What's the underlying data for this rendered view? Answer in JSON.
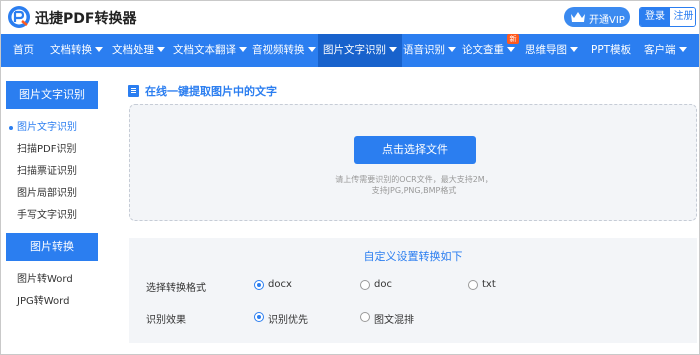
{
  "header": {
    "brand": "迅捷PDF转换器",
    "vip_label": "开通VIP",
    "login_label": "登录",
    "register_label": "注册"
  },
  "nav": {
    "items": [
      {
        "label": "首页"
      },
      {
        "label": "文档转换"
      },
      {
        "label": "文档处理"
      },
      {
        "label": "文档文本翻译"
      },
      {
        "label": "音视频转换"
      },
      {
        "label": "图片文字识别",
        "active": true
      },
      {
        "label": "语音识别"
      },
      {
        "label": "论文查重"
      },
      {
        "label": "思维导图"
      },
      {
        "label": "PPT模板"
      },
      {
        "label": "客户端"
      }
    ],
    "new_badge": "新"
  },
  "sidebar": {
    "section1_title": "图片文字识别",
    "section1_items": [
      "图片文字识别",
      "扫描PDF识别",
      "扫描票证识别",
      "图片局部识别",
      "手写文字识别"
    ],
    "section2_title": "图片转换",
    "section2_items": [
      "图片转Word",
      "JPG转Word"
    ]
  },
  "main": {
    "title": "在线一键提取图片中的文字",
    "upload_button": "点击选择文件",
    "hint_line1": "请上传需要识别的OCR文件，最大支持2M，",
    "hint_line2": "支持JPG,PNG,BMP格式",
    "settings_title": "自定义设置转换如下",
    "format_label": "选择转换格式",
    "format_options": [
      "docx",
      "doc",
      "txt"
    ],
    "format_selected": "docx",
    "effect_label": "识别效果",
    "effect_options": [
      "识别优先",
      "图文混排"
    ],
    "effect_selected": "识别优先"
  },
  "colors": {
    "primary": "#2b7ef0",
    "nav_active": "#1862cc",
    "panel_bg": "#f3f5f8",
    "badge": "#ff5a1f"
  }
}
